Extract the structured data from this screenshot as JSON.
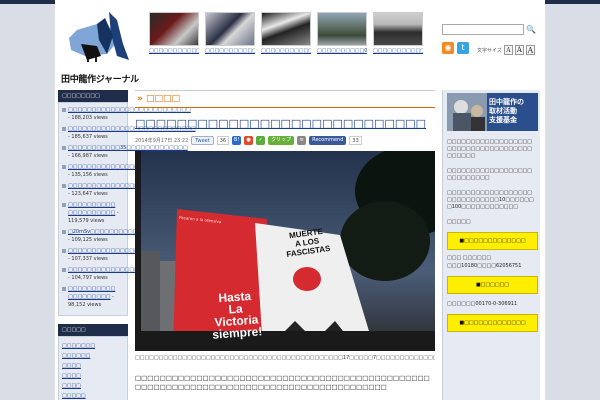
{
  "header": {
    "logo_text": "田中龍作ジャーナル",
    "thumbs": [
      {
        "caption": "□□□□□□□□□□□□□□□□□□□□"
      },
      {
        "caption": "□□□□□□□□□□□□□□□□□□□□"
      },
      {
        "caption": "□□□□□□□□□□□□□□□□□"
      },
      {
        "caption": "□□□□□□□□□□011□□□□□□□"
      },
      {
        "caption": "□□□□□□□□□□□□□□□□□"
      }
    ],
    "search_placeholder": "",
    "search_icon": "🔍",
    "font_size_label": "文字サイズ",
    "font_sizes": [
      "A",
      "A",
      "A"
    ]
  },
  "left_sidebar": {
    "ranking_title": "□□□□□□□□",
    "ranking": [
      {
        "title": "□□□□□□□□□□□□□□□□□□□□□□□□□□",
        "views": " - 188,203 views"
      },
      {
        "title": "□□□□□□□□□□□□□□□□□□□□□□□□□□□",
        "views": " - 185,637 views"
      },
      {
        "title": "□□□□□□□□□□□35□□□□□□□□□□□□□",
        "views": " - 166,987 views"
      },
      {
        "title": "□□□□□□□□□□□□□□□□□□□□□□□",
        "views": " - 135,156 views"
      },
      {
        "title": "□□□□□□□□□□□□□□□□□□",
        "views": " - 123,647 views"
      },
      {
        "title": "□□□□□□□□□□ □□□□□□□□□□",
        "views": " - 119,579 views"
      },
      {
        "title": "□20mSv□□□□□□□□□□□□□□□□□□□□□□□□",
        "views": " - 109,125 views"
      },
      {
        "title": "□□□□□□□□□□□□□□□□□□□□□□□□□",
        "views": " - 107,337 views"
      },
      {
        "title": "□□□□□□□□□□□□□□□□□□□□□□□□□□□□□",
        "views": " - 104,797 views"
      },
      {
        "title": "□□□□□□□□□□ □□□□□□□□□",
        "views": " - 98,152 views"
      }
    ],
    "category_title": "□□□□□",
    "categories": [
      "□□□□□□□",
      "□□□□□□",
      "□□□□",
      "□□□□",
      "□□□□",
      "□□□□□"
    ]
  },
  "article": {
    "category": "» □□□□",
    "title": "□□□□□□□□□□□□□□□□□□□□□□□□□□□□",
    "date": "2014年9月17日 23:22",
    "tweet_label": "Tweet",
    "tweet_count": "36",
    "clip_label": "クリップ",
    "fb_label": "Recommend",
    "fb_count": "33",
    "banner_texts": [
      "Hasta",
      "La",
      "Victoria",
      "siempre!"
    ],
    "banner2_texts": [
      "MUERTE",
      "A LOS",
      "FASCISTAS"
    ],
    "banner_small_text": "Pasaron a la ofensiva",
    "caption": "□□□□□□□□□□□□□□□□□□□□□□□□□□□□□□□□□□□□□□□□□□□□17□□□□□7□□□□□□□□□□□□□□□□□□□",
    "body": "□□□□□□□□□□□□□□□□□□□□□□□□□□□□□□□□□□□□□□□□□□□□□□□□□□□□□□□□□□□□□□□□□□□□□□□□□□□□□□□□□□□□□□□□□"
  },
  "right_sidebar": {
    "banner_line1": "田中龍作の",
    "banner_line2": "取材活動",
    "banner_line3": "支援基金",
    "para1": "□□□□□□□□□□□□□□□□□□□□□□□□□□□□□□□□□□□□□□□□□□",
    "para2": "□□□□□□□□□□□□□□□□□□□□□□□□□□□",
    "para3": "□□□□□□□□□□□□□□□□□□□□□□□□□□□□□10□□□□□□□100□□□□□□□□□□□□",
    "para4": "□□□□□",
    "button1": "■□□□□□□□□□□□□□",
    "bank_line1": "□□□ □□□□□□",
    "bank_line2": "□□□10180□□□□62056751",
    "button2": "■□□□□□□",
    "postal_line": "□□□□□□00170-0-306911",
    "button3": "■□□□□□□□□□□□□□"
  },
  "colors": {
    "navy": "#1f2d4a",
    "orange": "#e06a00",
    "link": "#1a3b8c",
    "yellow": "#ffee00",
    "banner_red": "#d42a30"
  }
}
